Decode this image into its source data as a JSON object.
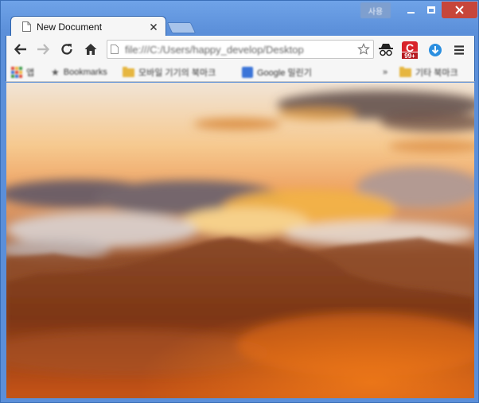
{
  "window": {
    "user_badge": "사용",
    "controls": {
      "minimize": "minimize",
      "maximize": "maximize",
      "close": "close"
    }
  },
  "tab": {
    "title": "New Document"
  },
  "toolbar": {
    "url": "file:///C:/Users/happy_develop/Desktop",
    "extensions": {
      "c_badge_letter": "C",
      "c_badge_count": "99+"
    }
  },
  "bookmarks": {
    "apps_label": "앱",
    "items": [
      {
        "label": "Bookmarks",
        "icon": "star-icon"
      },
      {
        "label": "모바일 기기의 북마크",
        "icon": "folder-icon"
      },
      {
        "label": "Google 밀린기",
        "icon": "google-icon"
      }
    ],
    "more": "»",
    "other_label": "기타 북마크"
  },
  "content": {
    "scene": "sunset mountains above clouds"
  },
  "colors": {
    "frame": "#5b8fd9",
    "close_button": "#c7463a",
    "toolbar": "#f6f6f6"
  }
}
